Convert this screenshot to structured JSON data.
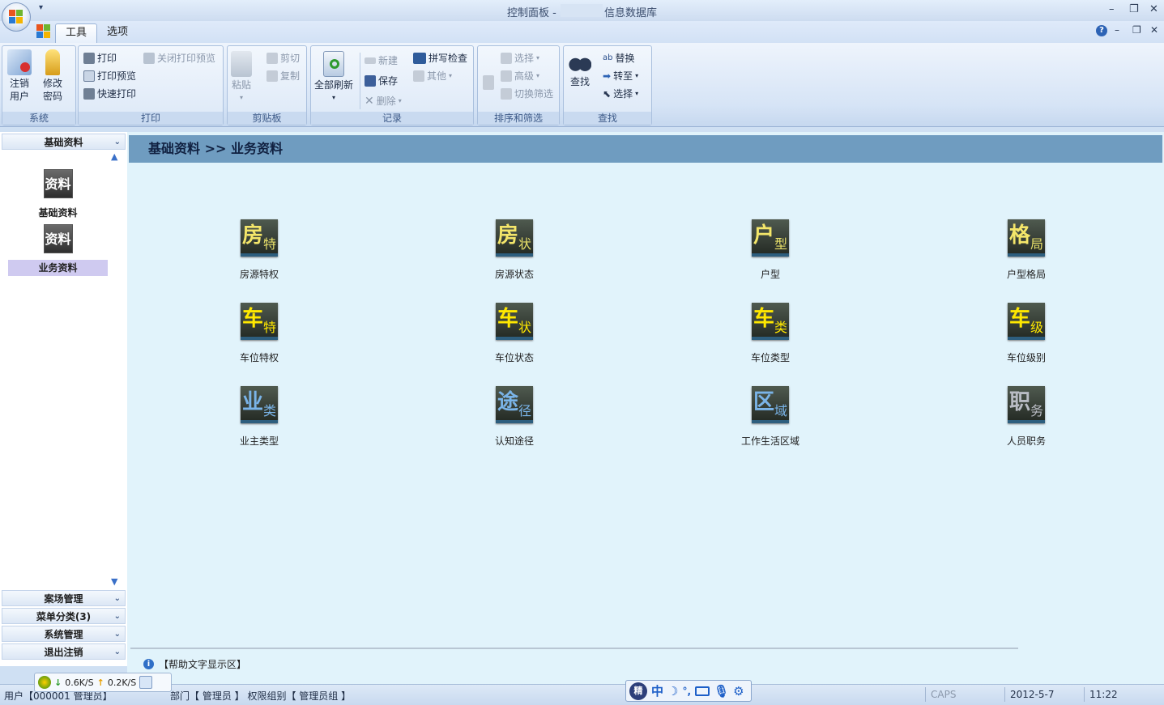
{
  "window": {
    "title_left": "控制面板 -",
    "title_right": "信息数据库",
    "minimize": "–",
    "restore": "❐",
    "close": "✕",
    "qat_arrow": "▾"
  },
  "tabs": [
    {
      "label": "工具",
      "active": true
    },
    {
      "label": "选项",
      "active": false
    }
  ],
  "right_icons": {
    "help": "?",
    "min": "–",
    "restore": "❐",
    "close": "✕"
  },
  "ribbon": {
    "system": {
      "label": "系统",
      "logout_l1": "注销",
      "logout_l2": "用户",
      "pwd_l1": "修改",
      "pwd_l2": "密码"
    },
    "print": {
      "label": "打印",
      "print": "打印",
      "preview": "打印预览",
      "quick": "快速打印",
      "close_preview": "关闭打印预览"
    },
    "clipboard": {
      "label": "剪贴板",
      "paste": "粘贴",
      "cut": "剪切",
      "copy": "复制"
    },
    "records": {
      "label": "记录",
      "refresh": "全部刷新",
      "new": "新建",
      "save": "保存",
      "delete": "删除",
      "spell": "拼写检查",
      "other": "其他"
    },
    "sort": {
      "label": "排序和筛选",
      "select": "选择",
      "advanced": "高级",
      "toggle": "切换筛选"
    },
    "find": {
      "label": "查找",
      "find": "查找",
      "replace": "替换",
      "goto": "转至",
      "select": "选择"
    }
  },
  "sidebar": {
    "header": "基础资料",
    "items": [
      {
        "icon": "资料",
        "label": "基础资料",
        "selected": false
      },
      {
        "icon": "资料",
        "label": "业务资料",
        "selected": true
      }
    ],
    "sections": [
      "案场管理",
      "菜单分类(3)",
      "系统管理",
      "退出注销"
    ],
    "chevron": "⌄"
  },
  "main": {
    "breadcrumb": "基础资料 >> 业务资料",
    "tiles": [
      {
        "a": "房",
        "b": "特",
        "label": "房源特权",
        "ac": "#f4e66a",
        "bc": "#e8e06a"
      },
      {
        "a": "房",
        "b": "状",
        "label": "房源状态",
        "ac": "#f4e66a",
        "bc": "#e8e06a"
      },
      {
        "a": "户",
        "b": "型",
        "label": "户型",
        "ac": "#f4e66a",
        "bc": "#e8e06a"
      },
      {
        "a": "格",
        "b": "局",
        "label": "户型格局",
        "ac": "#f4e66a",
        "bc": "#e8e06a"
      },
      {
        "a": "车",
        "b": "特",
        "label": "车位特权",
        "ac": "#ffe800",
        "bc": "#ffe800"
      },
      {
        "a": "车",
        "b": "状",
        "label": "车位状态",
        "ac": "#ffe800",
        "bc": "#ffe800"
      },
      {
        "a": "车",
        "b": "类",
        "label": "车位类型",
        "ac": "#ffe800",
        "bc": "#ffe800"
      },
      {
        "a": "车",
        "b": "级",
        "label": "车位级别",
        "ac": "#ffe800",
        "bc": "#ffe800"
      },
      {
        "a": "业",
        "b": "类",
        "label": "业主类型",
        "ac": "#7ab4e8",
        "bc": "#7ab4e8"
      },
      {
        "a": "途",
        "b": "径",
        "label": "认知途径",
        "ac": "#7ab4e8",
        "bc": "#7ab4e8"
      },
      {
        "a": "区",
        "b": "域",
        "label": "工作生活区域",
        "ac": "#7ab4e8",
        "bc": "#7ab4e8"
      },
      {
        "a": "职",
        "b": "务",
        "label": "人员职务",
        "ac": "#b9bcc4",
        "bc": "#b9bcc4"
      }
    ],
    "help_text": "【帮助文字显示区】"
  },
  "statusbar": {
    "user": "用户【000001 管理员】",
    "dept": "部门【 管理员 】 权限组别【 管理员组 】",
    "caps": "CAPS",
    "date": "2012-5-7",
    "time": "11:22"
  },
  "net": {
    "down": "0.6K/S",
    "up": "0.2K/S"
  },
  "ime": {
    "jing": "精",
    "zh": "中"
  }
}
